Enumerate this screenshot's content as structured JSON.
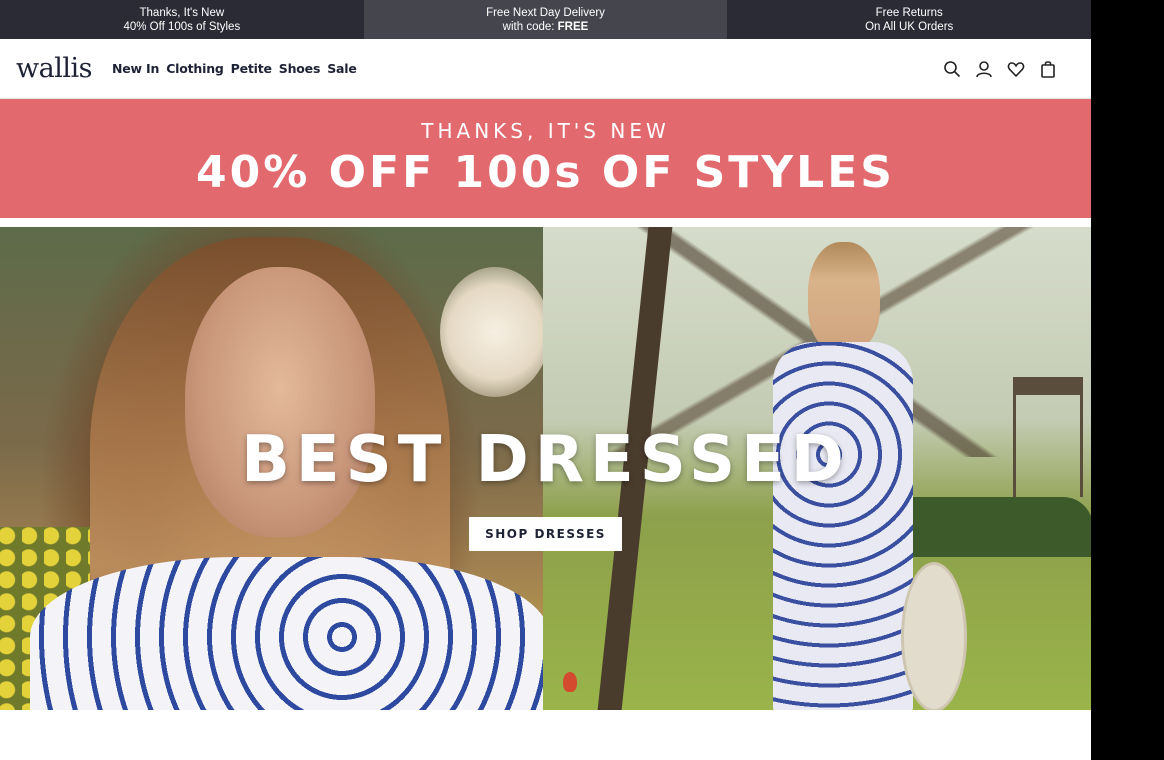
{
  "promo_strip": [
    {
      "line1": "Thanks, It's New",
      "line2": "40% Off 100s of Styles"
    },
    {
      "line1": "Free Next Day Delivery",
      "line2_prefix": "with code: ",
      "line2_code": "FREE"
    },
    {
      "line1": "Free Returns",
      "line2": "On All UK Orders"
    }
  ],
  "header": {
    "logo": "wallis",
    "nav": [
      "New In",
      "Clothing",
      "Petite",
      "Shoes",
      "Sale"
    ],
    "icons": [
      "search-icon",
      "account-icon",
      "wishlist-heart-icon",
      "shopping-bag-icon"
    ]
  },
  "sale_banner": {
    "kicker": "THANKS, IT'S NEW",
    "headline": "40% OFF 100s OF STYLES",
    "background": "#e26a6e"
  },
  "hero": {
    "title": "BEST DRESSED",
    "cta": "SHOP DRESSES"
  },
  "colors": {
    "promo_bg": "#2b2b36",
    "promo_active_bg": "#45454e",
    "brand_navy": "#1e2235"
  }
}
